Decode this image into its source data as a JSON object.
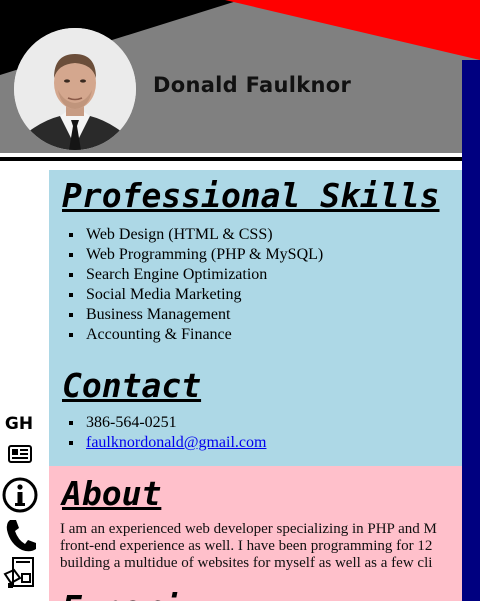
{
  "profile": {
    "name": "Donald Faulknor"
  },
  "sidebar": {
    "gh_label": "GH"
  },
  "skills": {
    "heading": "Professional Skills",
    "items": [
      "Web Design (HTML & CSS)",
      "Web Programming (PHP & MySQL)",
      "Search Engine Optimization",
      "Social Media Marketing",
      "Business Management",
      "Accounting & Finance"
    ]
  },
  "contact": {
    "heading": "Contact",
    "phone": "386-564-0251",
    "email": "faulknordonald@gmail.com"
  },
  "about": {
    "heading": "About",
    "lines": [
      "I am an experienced web developer specializing in PHP and M",
      "front-end experience as well. I have been programming for 12",
      "building a multidue of websites for myself as well as a few cli"
    ]
  },
  "next_heading_partial": "Experi",
  "colors": {
    "header_gray": "#808080",
    "skills_bg": "#add8e6",
    "about_bg": "#ffc0cb",
    "accent_red": "#ff0000",
    "side_navy": "#000080"
  }
}
